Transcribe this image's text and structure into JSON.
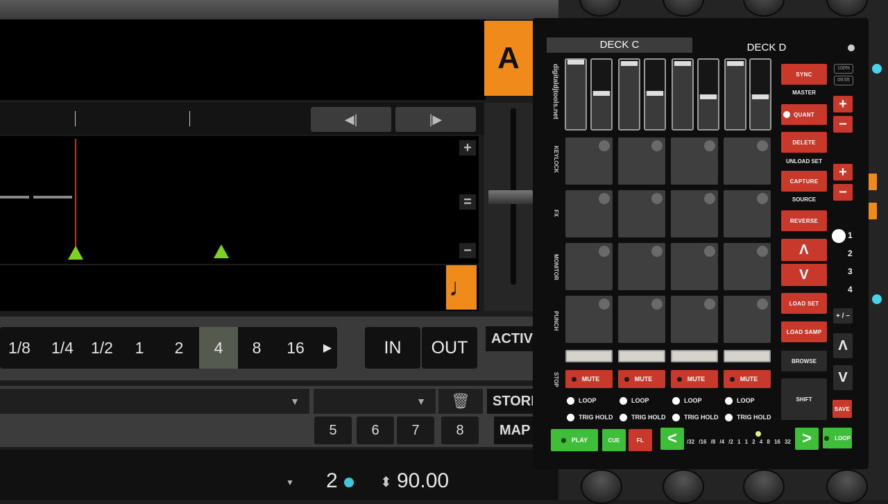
{
  "deck_label": "A",
  "nav": {
    "prev": "◀|",
    "next": "|▶"
  },
  "zoom": {
    "plus": "+",
    "equal": "=",
    "minus": "−"
  },
  "note_icon": "♩",
  "beat_sizes": [
    "/8",
    "1/8",
    "1/4",
    "1/2",
    "1",
    "2",
    "4",
    "8",
    "16"
  ],
  "beat_selected": "4",
  "beat_arrow": "▶",
  "loop": {
    "in": "IN",
    "out": "OUT"
  },
  "active_label": "ACTIV",
  "store_label": "STORI",
  "map_label": "MAP",
  "hotcue_numbers": [
    "5",
    "6",
    "7",
    "8"
  ],
  "deck_number": "2",
  "bpm": "90.00",
  "bpm_arrows": "⬍",
  "dropdown_arrow": "▼",
  "remix": {
    "tab_c": "DECK C",
    "tab_d": "DECK D",
    "watermark": "digitaldjtools.net",
    "row_labels": [
      "KEYLOCK",
      "FX",
      "MONITOR",
      "PUNCH",
      "STOP"
    ],
    "slot_levels": [
      1.0,
      0.55,
      0.98,
      0.55,
      0.98,
      0.5,
      0.98,
      0.5
    ],
    "mute": "MUTE",
    "loop": "LOOP",
    "trig_hold": "TRIG HOLD",
    "sync": "SYNC",
    "master": "MASTER",
    "quant": "QUANT",
    "delete": "DELETE",
    "unload_set": "UNLOAD SET",
    "capture": "CAPTURE",
    "source": "SOURCE",
    "reverse": "REVERSE",
    "up": "Λ",
    "down": "V",
    "load_set": "LOAD SET",
    "load_samp": "LOAD SAMP",
    "browse": "BROWSE",
    "shift": "SHIFT",
    "save": "SAVE",
    "plus": "+",
    "minus": "−",
    "plusminus": "+ / −",
    "pct": "100%",
    "time": "09:55",
    "page_numbers": [
      "1",
      "2",
      "3",
      "4"
    ],
    "play": "PLAY",
    "cue": "CUE",
    "fl": "FL",
    "left_arrow": "<",
    "right_arrow": ">",
    "loop_btn": "LOOP",
    "step_scale": [
      "/32",
      "/16",
      "/8",
      "/4",
      "/2",
      "1",
      "1",
      "2",
      "4",
      "8",
      "16",
      "32"
    ]
  },
  "colors": {
    "orange": "#f08a1a",
    "red": "#c8392b",
    "green": "#3fbe3a",
    "cyan": "#47d3ea"
  }
}
